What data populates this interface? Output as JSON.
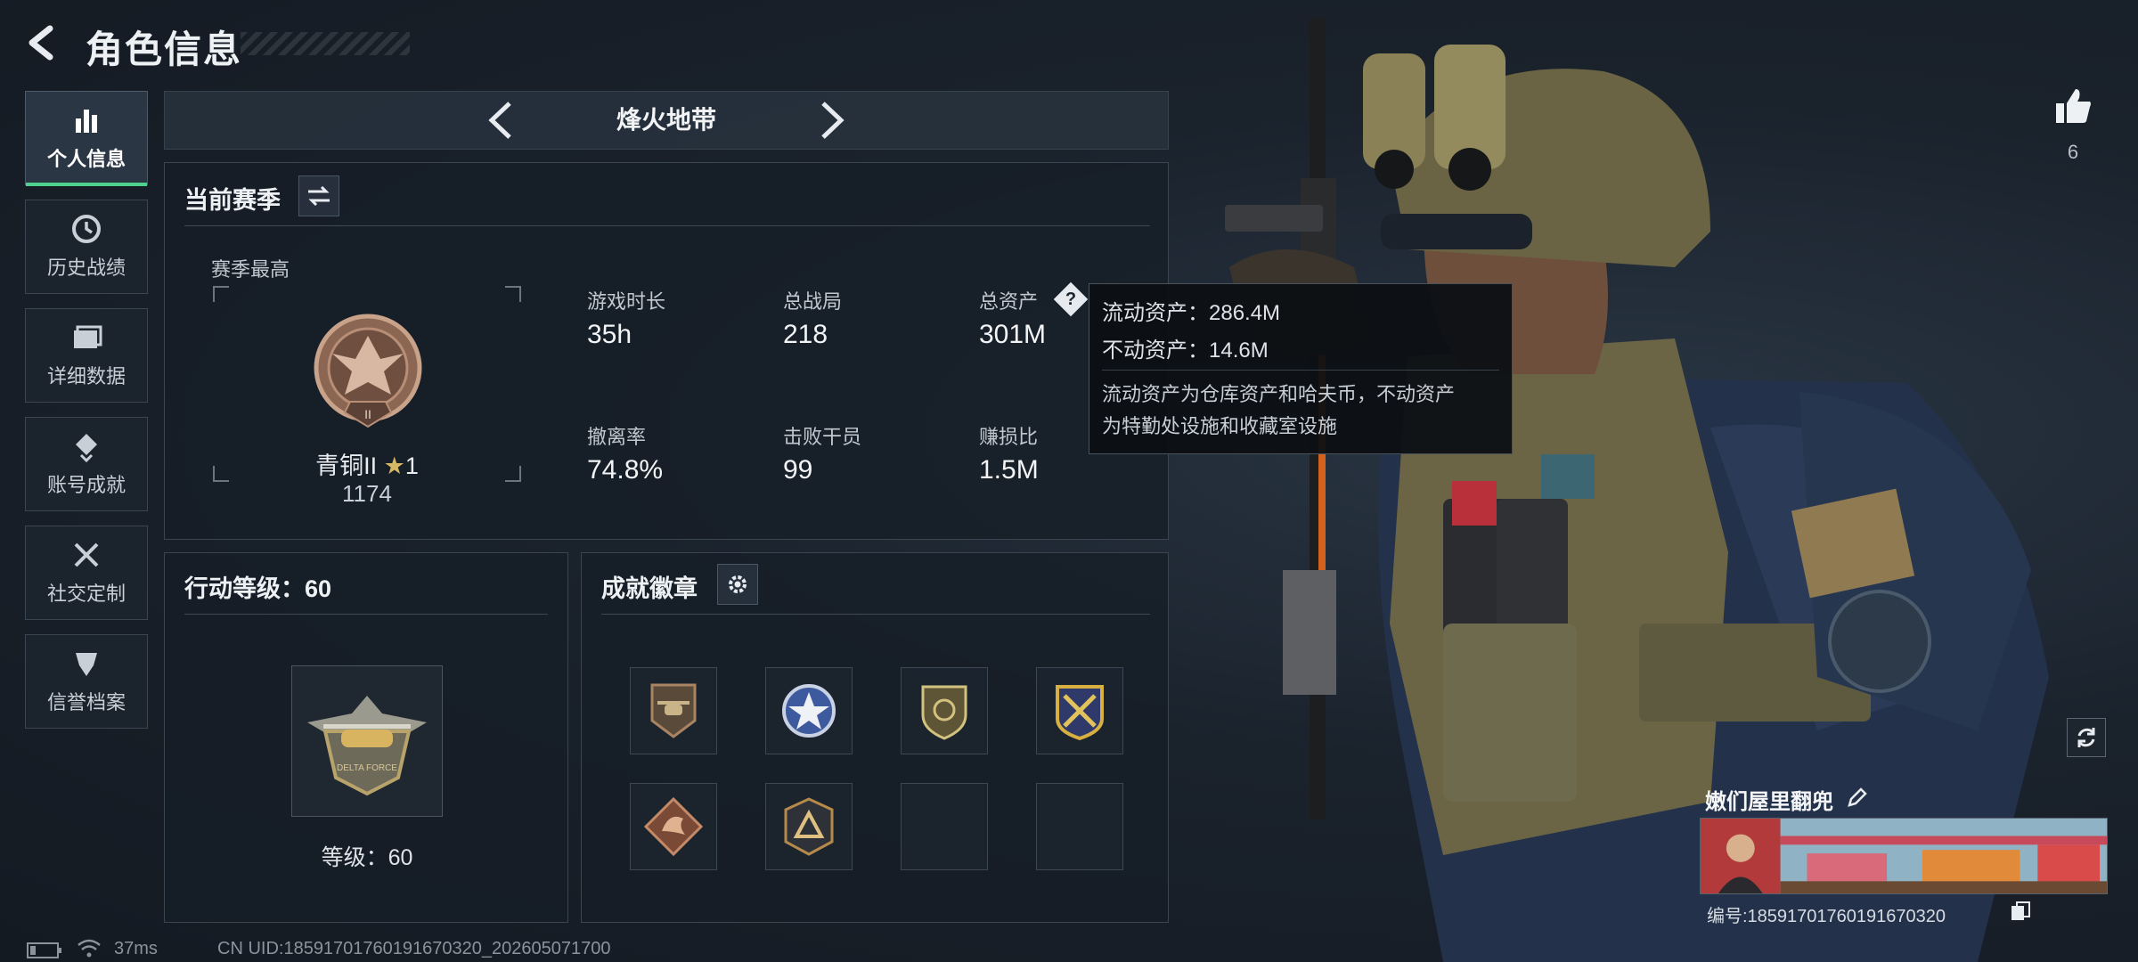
{
  "header": {
    "title": "角色信息"
  },
  "sidebar": {
    "items": [
      {
        "label": "个人信息",
        "icon": "bar-chart-icon",
        "active": true
      },
      {
        "label": "历史战绩",
        "icon": "clock-icon"
      },
      {
        "label": "详细数据",
        "icon": "folder-icon"
      },
      {
        "label": "账号成就",
        "icon": "achievement-icon"
      },
      {
        "label": "社交定制",
        "icon": "tools-icon"
      },
      {
        "label": "信誉档案",
        "icon": "shield-icon"
      }
    ]
  },
  "mode": {
    "label": "烽火地带"
  },
  "season": {
    "title": "当前赛季",
    "best_label": "赛季最高",
    "rank_name": "青铜II",
    "rank_stars": "1",
    "rank_points": "1174",
    "rank_badge_text": "II",
    "stats": [
      {
        "label": "游戏时长",
        "value": "35h"
      },
      {
        "label": "总战局",
        "value": "218"
      },
      {
        "label": "总资产",
        "value": "301M"
      },
      {
        "label": "撤离率",
        "value": "74.8%"
      },
      {
        "label": "击败干员",
        "value": "99"
      },
      {
        "label": "赚损比",
        "value": "1.5M"
      }
    ]
  },
  "tooltip": {
    "line1": "流动资产：286.4M",
    "line2": "不动资产：14.6M",
    "desc1": "流动资产为仓库资产和哈夫币，不动资产",
    "desc2": "为特勤处设施和收藏室设施"
  },
  "level": {
    "title": "行动等级：60",
    "caption": "等级：60",
    "emblem_text": "DELTA FORCE"
  },
  "badges": {
    "title": "成就徽章",
    "slots": [
      {
        "icon": "helicopter-badge-icon"
      },
      {
        "icon": "star-badge-icon"
      },
      {
        "icon": "shield-badge-icon"
      },
      {
        "icon": "crossed-badge-icon"
      },
      {
        "icon": "dragon-badge-icon"
      },
      {
        "icon": "triangle-badge-icon"
      },
      {
        "icon": ""
      },
      {
        "icon": ""
      }
    ]
  },
  "likes": {
    "count": "6"
  },
  "player": {
    "name": "嫩们屋里翻兜",
    "id_line": "编号:18591701760191670320"
  },
  "status": {
    "ping": "37ms",
    "uid": "CN UID:18591701760191670320_202605071700"
  },
  "colors": {
    "accent": "#4fd18e",
    "panel": "#161d26",
    "bronze": "#a57a62"
  }
}
